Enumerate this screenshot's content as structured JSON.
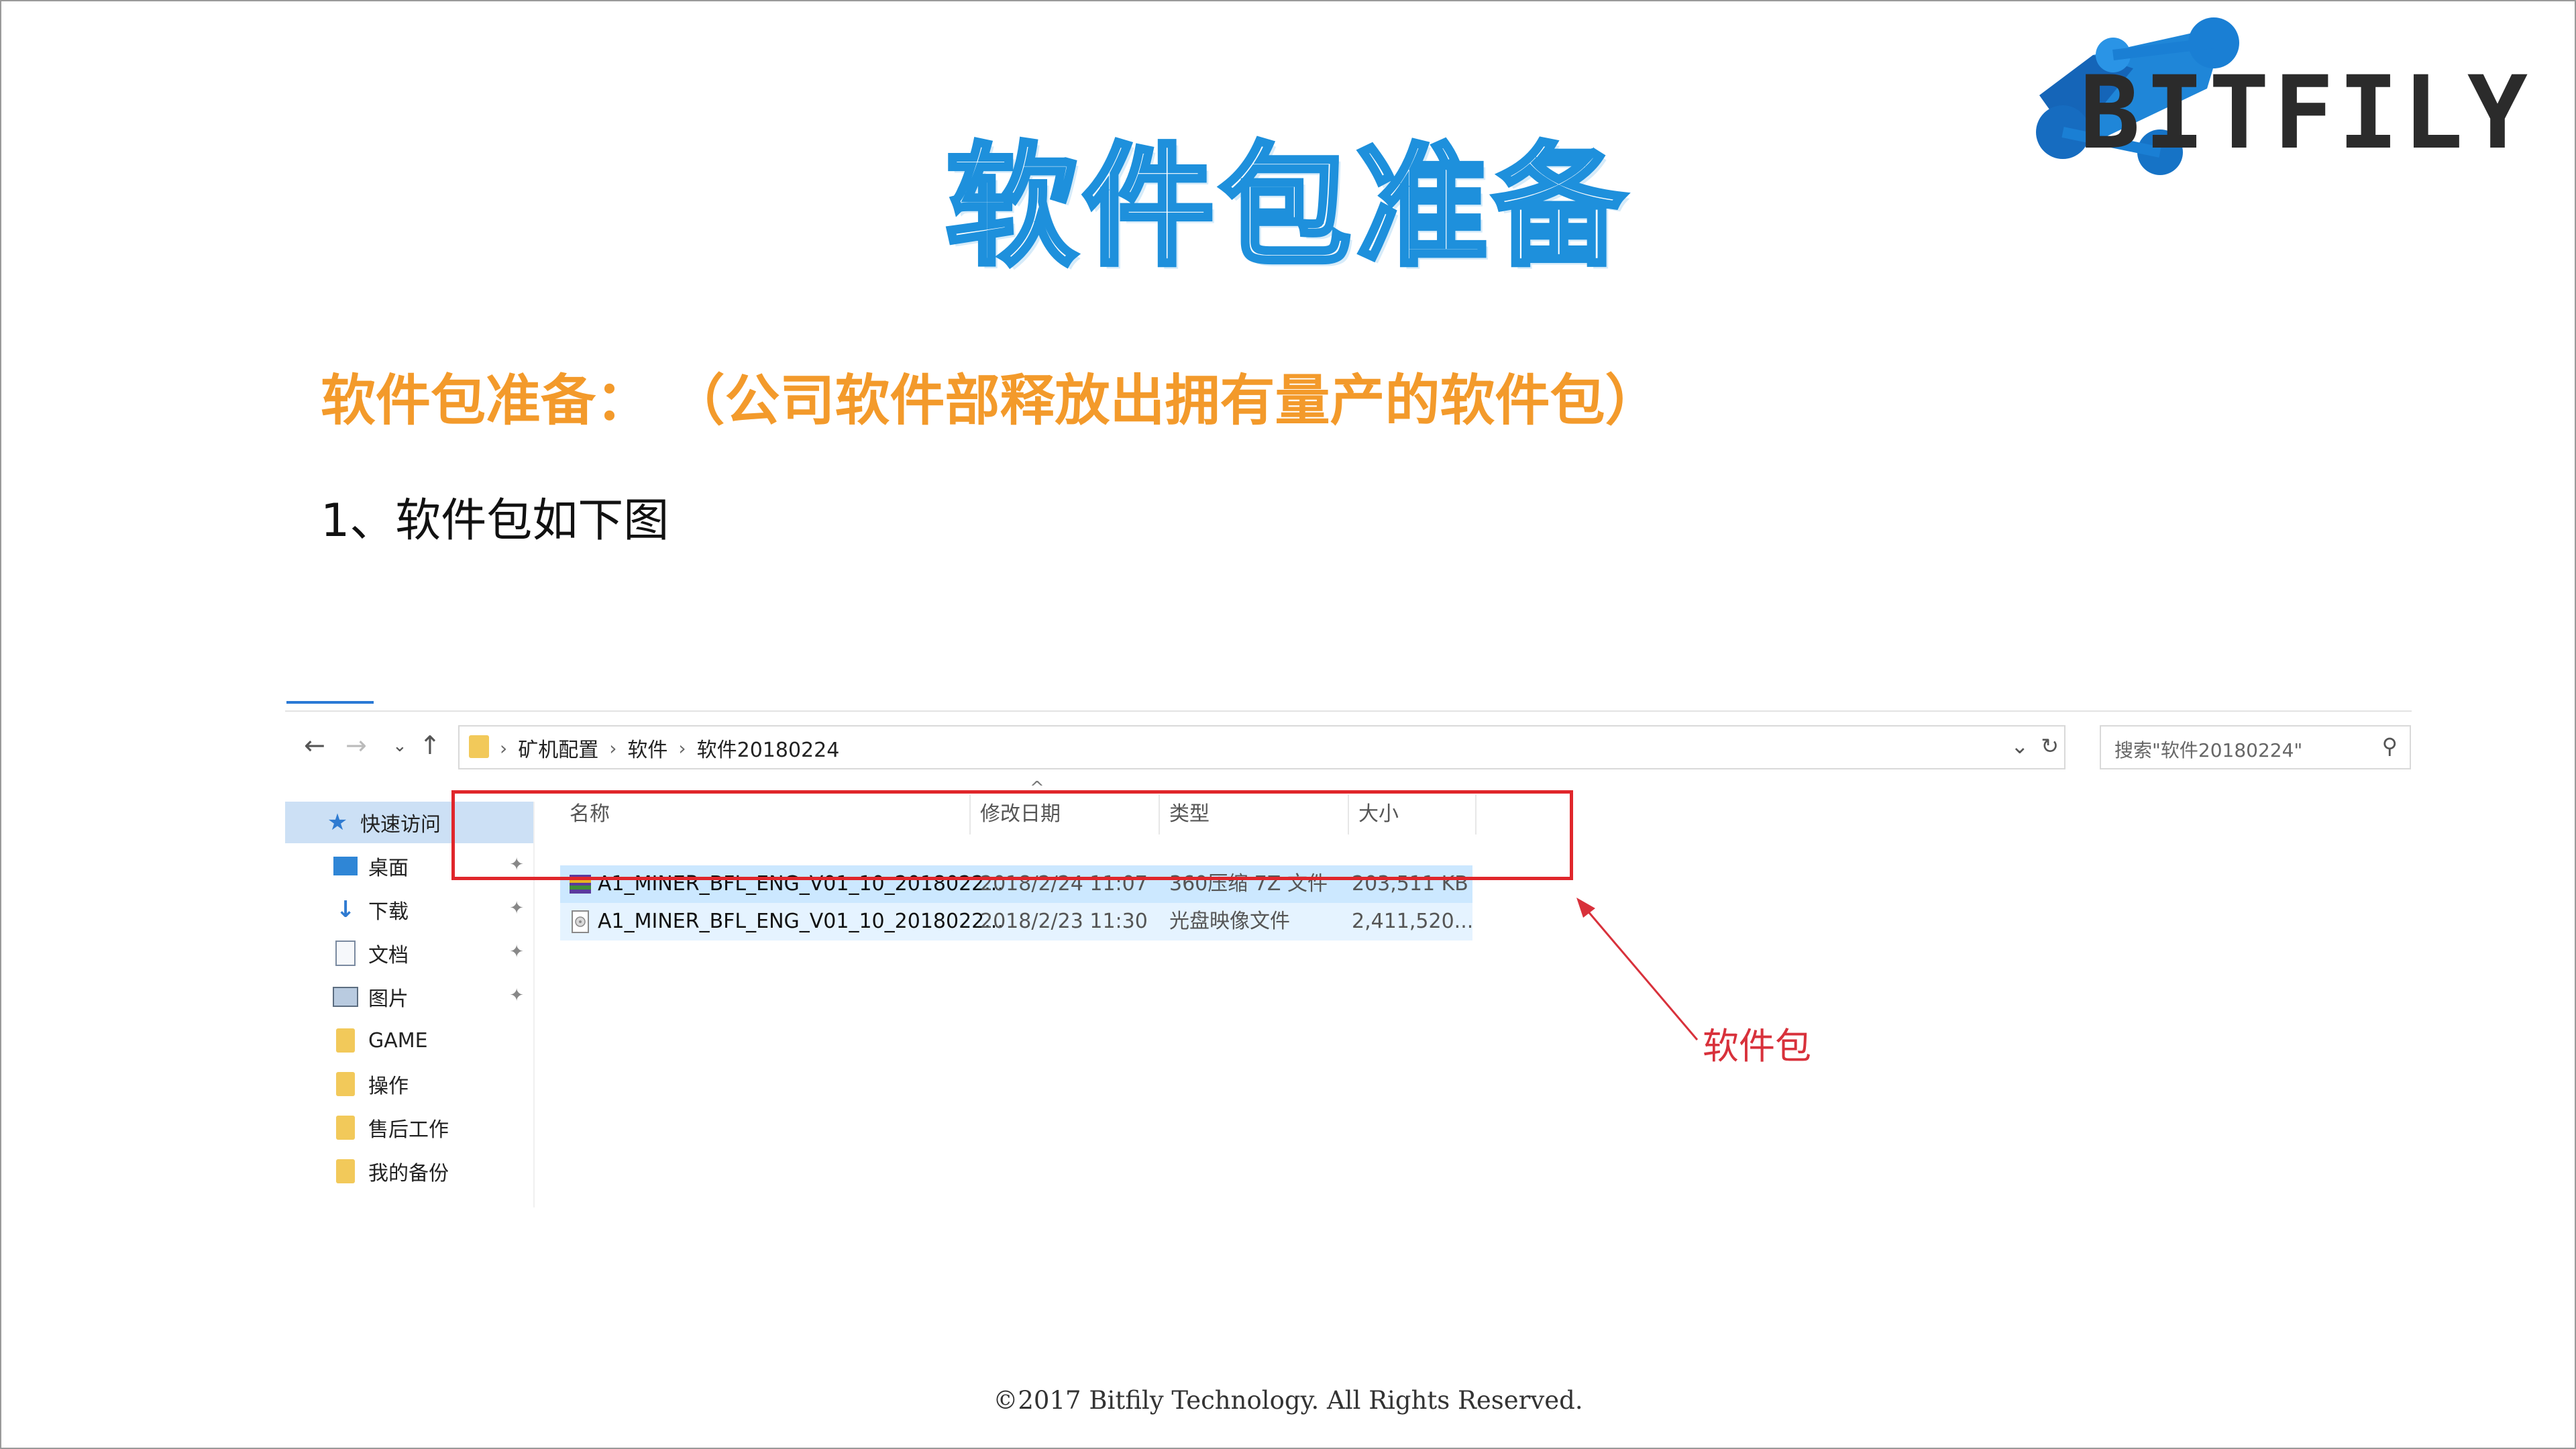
{
  "slide": {
    "title": "软件包准备",
    "logo_text": "BITFILY",
    "subtitle": "软件包准备： （公司软件部释放出拥有量产的软件包）",
    "step": "1、软件包如下图",
    "callout": "软件包",
    "footer": "©2017 Bitfily Technology. All Rights Reserved.",
    "colors": {
      "title": "#1e90dc",
      "subtitle": "#f39a2b",
      "highlight": "#e0262b"
    }
  },
  "explorer": {
    "breadcrumb": [
      "矿机配置",
      "软件",
      "软件20180224"
    ],
    "search_placeholder": "搜索\"软件20180224\"",
    "sidebar": [
      {
        "label": "快速访问",
        "icon": "star-icon"
      },
      {
        "label": "桌面",
        "icon": "desktop-icon",
        "pinned": true
      },
      {
        "label": "下载",
        "icon": "download-icon",
        "pinned": true
      },
      {
        "label": "文档",
        "icon": "document-icon",
        "pinned": true
      },
      {
        "label": "图片",
        "icon": "picture-icon",
        "pinned": true
      },
      {
        "label": "GAME",
        "icon": "folder-icon"
      },
      {
        "label": "操作",
        "icon": "folder-icon"
      },
      {
        "label": "售后工作",
        "icon": "folder-icon"
      },
      {
        "label": "我的备份",
        "icon": "folder-icon"
      }
    ],
    "columns": [
      "名称",
      "修改日期",
      "类型",
      "大小"
    ],
    "files": [
      {
        "name": "A1_MINER_BFL_ENG_V01_10_2018022...",
        "date": "2018/2/24 11:07",
        "type": "360压缩 7Z 文件",
        "size": "203,511 KB"
      },
      {
        "name": "A1_MINER_BFL_ENG_V01_10_2018022...",
        "date": "2018/2/23 11:30",
        "type": "光盘映像文件",
        "size": "2,411,520..."
      }
    ]
  }
}
